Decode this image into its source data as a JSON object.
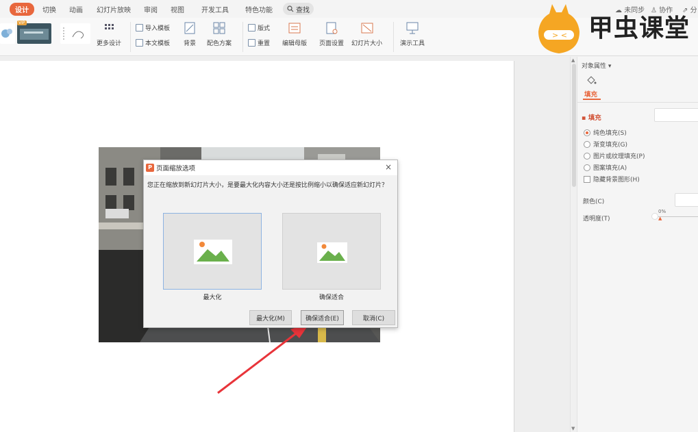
{
  "menu": {
    "tabs": [
      "设计",
      "切换",
      "动画",
      "幻灯片放映",
      "审阅",
      "视图",
      "开发工具",
      "特色功能"
    ],
    "search": "查找",
    "sync": "未同步",
    "collab": "协作",
    "share": "分"
  },
  "ribbon": {
    "vip_badge": "VIP",
    "more_design": "更多设计",
    "import_template": "导入模板",
    "text_template": "本文模板",
    "background": "背景",
    "color_scheme": "配色方案",
    "layout": "版式",
    "reset": "重置",
    "edit_master": "编辑母版",
    "page_setup": "页面设置",
    "slide_size": "幻灯片大小",
    "present_tools": "演示工具"
  },
  "logo": {
    "text": "甲虫课堂"
  },
  "dialog": {
    "title": "页面缩放选项",
    "message": "您正在缩放到新幻灯片大小，是要最大化内容大小还是按比例缩小以确保适应新幻灯片？",
    "option_max_label": "最大化",
    "option_fit_label": "确保适合",
    "btn_max": "最大化(M)",
    "btn_fit": "确保适合(E)",
    "btn_cancel": "取消(C)",
    "close": "×"
  },
  "panel": {
    "header": "对象属性",
    "tab_fill": "填充",
    "section_fill": "填充",
    "radio_solid": "纯色填充(S)",
    "radio_gradient": "渐变填充(G)",
    "radio_picture": "图片或纹理填充(P)",
    "radio_pattern": "图案填充(A)",
    "check_hide_bg": "隐藏背景图形(H)",
    "color_label": "颜色(C)",
    "transparency_label": "透明度(T)",
    "transparency_value": "0%"
  },
  "colors": {
    "accent": "#e8673d",
    "selection": "#8db3e2",
    "arrow": "#e8343a"
  }
}
